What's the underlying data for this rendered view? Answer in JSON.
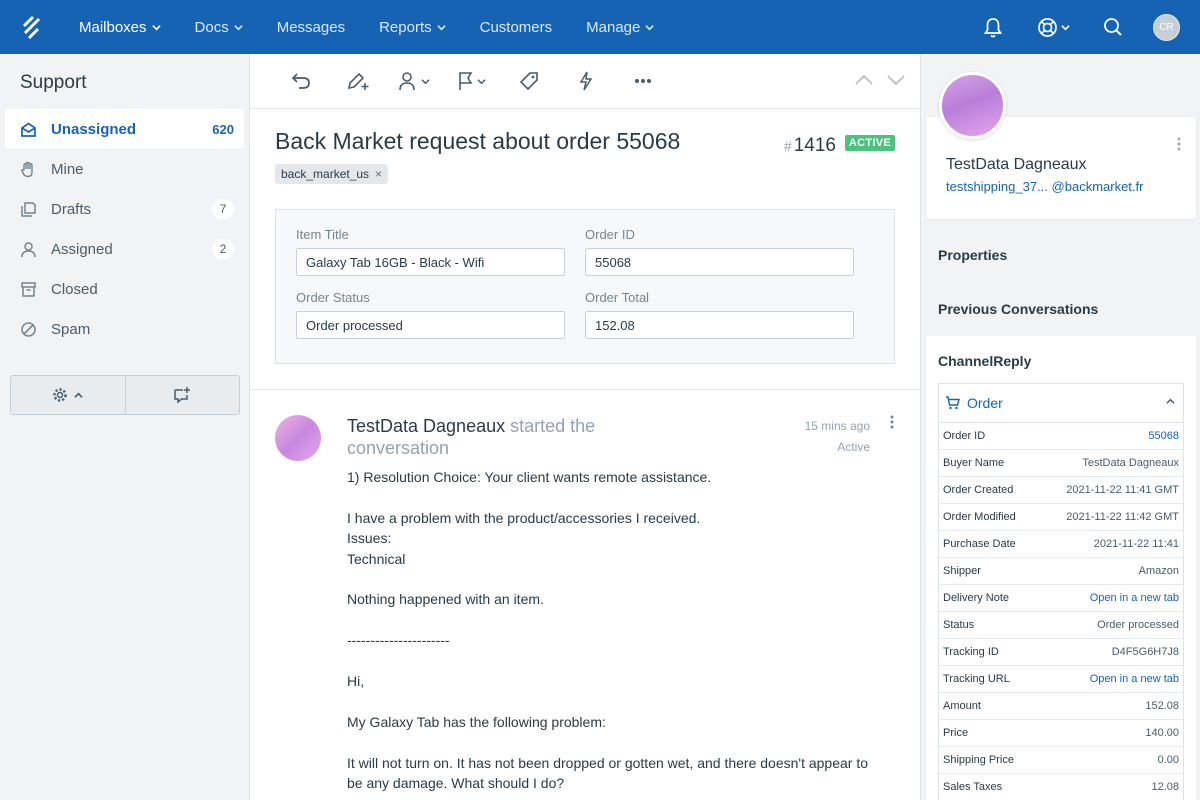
{
  "nav": {
    "items": [
      {
        "label": "Mailboxes",
        "dropdown": true,
        "active": true
      },
      {
        "label": "Docs",
        "dropdown": true,
        "active": false
      },
      {
        "label": "Messages",
        "dropdown": false,
        "active": false
      },
      {
        "label": "Reports",
        "dropdown": true,
        "active": false
      },
      {
        "label": "Customers",
        "dropdown": false,
        "active": false
      },
      {
        "label": "Manage",
        "dropdown": true,
        "active": false
      }
    ],
    "user_initials": "CR",
    "icons": [
      "bell-icon",
      "lifebuoy-icon",
      "search-icon"
    ]
  },
  "sidebar": {
    "title": "Support",
    "items": [
      {
        "label": "Unassigned",
        "count": "620",
        "icon": "inbox-icon",
        "active": true
      },
      {
        "label": "Mine",
        "count": "",
        "icon": "hand-icon",
        "active": false
      },
      {
        "label": "Drafts",
        "count": "7",
        "icon": "drafts-icon",
        "active": false
      },
      {
        "label": "Assigned",
        "count": "2",
        "icon": "person-icon",
        "active": false
      },
      {
        "label": "Closed",
        "count": "",
        "icon": "archive-icon",
        "active": false
      },
      {
        "label": "Spam",
        "count": "",
        "icon": "ban-icon",
        "active": false
      }
    ]
  },
  "conversation": {
    "subject": "Back Market request about order 55068",
    "number_prefix": "#",
    "number": "1416",
    "status": "ACTIVE",
    "tag": "back_market_us",
    "tag_remove": "×",
    "fields": {
      "item_title_label": "Item Title",
      "item_title": "Galaxy Tab 16GB - Black - Wifi",
      "order_id_label": "Order ID",
      "order_id": "55068",
      "order_status_label": "Order Status",
      "order_status": "Order processed",
      "order_total_label": "Order Total",
      "order_total": "152.08"
    },
    "thread": {
      "author": "TestData Dagneaux",
      "action": " started the conversation",
      "time": "15 mins ago",
      "state": "Active",
      "paragraphs": [
        "1) Resolution Choice: Your client wants remote assistance.",
        "I have a problem with the product/accessories I received.\nIssues:\nTechnical",
        "Nothing happened with an item.",
        "----------------------",
        "Hi,",
        "My Galaxy Tab has the following problem:",
        "It will not turn on. It has not been dropped or gotten wet, and there doesn't appear to be any damage. What should I do?"
      ]
    }
  },
  "customer": {
    "name": "TestData Dagneaux",
    "email_local": "testshipping_37...",
    "email_domain": "@backmarket.fr"
  },
  "right_panel": {
    "properties": "Properties",
    "previous_conversations": "Previous Conversations",
    "channelreply_title": "ChannelReply",
    "order_header": "Order",
    "order_rows": [
      {
        "label": "Order ID",
        "value": "55068",
        "link": true
      },
      {
        "label": "Buyer Name",
        "value": "TestData Dagneaux",
        "link": false
      },
      {
        "label": "Order Created",
        "value": "2021-11-22 11:41 GMT",
        "link": false
      },
      {
        "label": "Order Modified",
        "value": "2021-11-22 11:42 GMT",
        "link": false
      },
      {
        "label": "Purchase Date",
        "value": "2021-11-22 11:41",
        "link": false
      },
      {
        "label": "Shipper",
        "value": "Amazon",
        "link": false
      },
      {
        "label": "Delivery Note",
        "value": "Open in a new tab",
        "link": true
      },
      {
        "label": "Status",
        "value": "Order processed",
        "link": false
      },
      {
        "label": "Tracking ID",
        "value": "D4F5G6H7J8",
        "link": false
      },
      {
        "label": "Tracking URL",
        "value": "Open in a new tab",
        "link": true
      },
      {
        "label": "Amount",
        "value": "152.08",
        "link": false
      },
      {
        "label": "Price",
        "value": "140.00",
        "link": false
      },
      {
        "label": "Shipping Price",
        "value": "0.00",
        "link": false
      },
      {
        "label": "Sales Taxes",
        "value": "12.08",
        "link": false
      }
    ]
  },
  "colors": {
    "brand": "#1763b3",
    "active_badge": "#4bc27d",
    "sidebar_bg": "#f1f3f5"
  }
}
